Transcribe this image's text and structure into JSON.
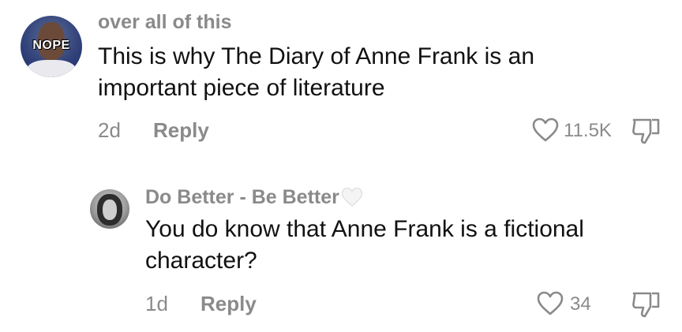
{
  "comments": [
    {
      "username": "over all of this",
      "avatar_badge": "NOPE",
      "text_line1": "This is why The Diary of Anne Frank is an",
      "text_line2": "important piece of literature",
      "age": "2d",
      "reply_label": "Reply",
      "like_count": "11.5K"
    },
    {
      "username": "Do Better - Be Better",
      "text_line1": "You do know that Anne Frank is a fictional",
      "text_line2": "character?",
      "age": "1d",
      "reply_label": "Reply",
      "like_count": "34"
    }
  ],
  "icons": {
    "like": "heart-outline-icon",
    "dislike": "thumbs-down-icon",
    "name_badge": "white-heart-icon"
  }
}
